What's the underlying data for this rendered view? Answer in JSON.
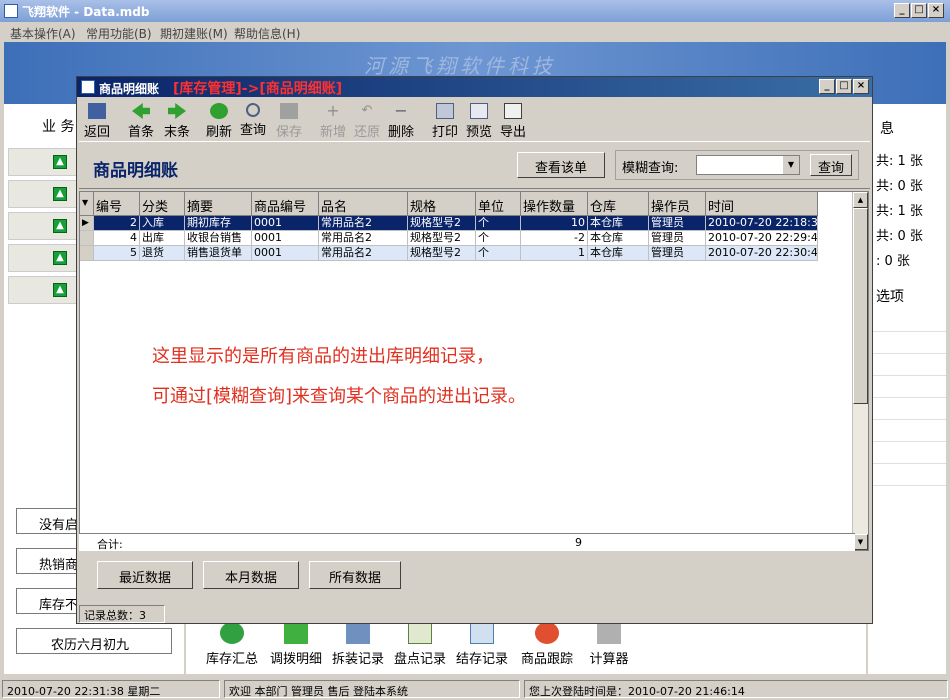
{
  "app": {
    "title": "飞翔软件 - Data.mdb",
    "menu": [
      "基本操作(A)",
      "常用功能(B)",
      "期初建账(M)",
      "帮助信息(H)"
    ],
    "banner_text": "河源飞翔软件科技"
  },
  "left": {
    "tab_label": "业 务",
    "buttons": [
      "没有启",
      "热销商",
      "库存不",
      "农历六月初九"
    ]
  },
  "right": {
    "tab_label": "息",
    "lines": [
      "共: 1 张",
      "共: 0 张",
      "共: 1 张",
      "共: 0 张",
      ": 0 张"
    ],
    "options_label": "选项"
  },
  "bottom_tools": [
    "库存汇总",
    "调拨明细",
    "拆装记录",
    "盘点记录",
    "结存记录",
    "商品跟踪",
    "计算器"
  ],
  "status": {
    "datetime": "2010-07-20 22:31:38 星期二",
    "welcome": "欢迎 本部门 管理员 售后 登陆本系统",
    "last_login": "您上次登陆时间是：2010-07-20 21:46:14"
  },
  "dialog": {
    "title": "商品明细账",
    "path_label": "[库存管理]->[商品明细账]",
    "toolbar": [
      {
        "label": "返回",
        "enabled": true
      },
      {
        "label": "首条",
        "enabled": true
      },
      {
        "label": "末条",
        "enabled": true
      },
      {
        "label": "刷新",
        "enabled": true
      },
      {
        "label": "查询",
        "enabled": true
      },
      {
        "label": "保存",
        "enabled": false
      },
      {
        "label": "新增",
        "enabled": false
      },
      {
        "label": "还原",
        "enabled": false
      },
      {
        "label": "删除",
        "enabled": true
      },
      {
        "label": "打印",
        "enabled": true
      },
      {
        "label": "预览",
        "enabled": true
      },
      {
        "label": "导出",
        "enabled": true
      }
    ],
    "page_title": "商品明细账",
    "view_button": "查看该单",
    "fuzzy_label": "模糊查询:",
    "fuzzy_value": "",
    "search_button": "查询",
    "columns": [
      "编号",
      "分类",
      "摘要",
      "商品编号",
      "品名",
      "规格",
      "单位",
      "操作数量",
      "仓库",
      "操作员",
      "时间"
    ],
    "rows": [
      [
        "2",
        "入库",
        "期初库存",
        "0001",
        "常用品名2",
        "规格型号2",
        "个",
        "10",
        "本仓库",
        "管理员",
        "2010-07-20 22:18:3"
      ],
      [
        "4",
        "出库",
        "收银台销售",
        "0001",
        "常用品名2",
        "规格型号2",
        "个",
        "-2",
        "本仓库",
        "管理员",
        "2010-07-20 22:29:4"
      ],
      [
        "5",
        "退货",
        "销售退货单",
        "0001",
        "常用品名2",
        "规格型号2",
        "个",
        "1",
        "本仓库",
        "管理员",
        "2010-07-20 22:30:4"
      ]
    ],
    "note_line1": "这里显示的是所有商品的进出库明细记录，",
    "note_line2": "可通过[模糊查询]来查询某个商品的进出记录。",
    "total_label": "合计:",
    "total_qty": "9",
    "buttons": [
      "最近数据",
      "本月数据",
      "所有数据"
    ],
    "record_count": "记录总数：3"
  },
  "colors": {
    "accent": "#0a246a",
    "note": "#e03020",
    "path_red": "#ff3030"
  }
}
